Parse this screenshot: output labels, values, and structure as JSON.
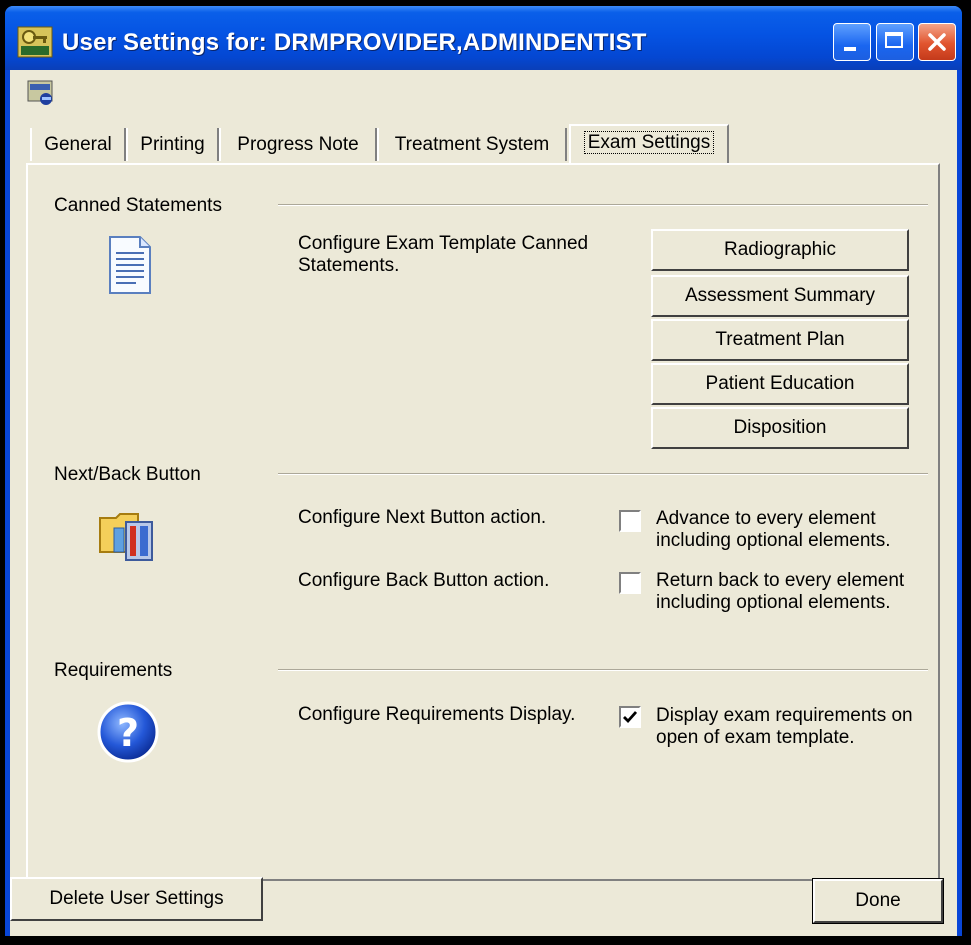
{
  "window": {
    "title": "User Settings for: DRMPROVIDER,ADMINDENTIST"
  },
  "tabs": [
    {
      "label": "General"
    },
    {
      "label": "Printing"
    },
    {
      "label": "Progress Note"
    },
    {
      "label": "Treatment System"
    },
    {
      "label": "Exam Settings",
      "active": true
    }
  ],
  "canned": {
    "heading": "Canned Statements",
    "description": "Configure Exam Template Canned Statements.",
    "buttons": [
      "Radiographic",
      "Assessment Summary",
      "Treatment Plan",
      "Patient Education",
      "Disposition"
    ]
  },
  "nextback": {
    "heading": "Next/Back Button",
    "next_label": "Configure Next Button action.",
    "next_option": "Advance to every element including optional elements.",
    "next_checked": false,
    "back_label": "Configure Back Button action.",
    "back_option": "Return back to every element including optional elements.",
    "back_checked": false
  },
  "requirements": {
    "heading": "Requirements",
    "label": "Configure Requirements Display.",
    "option": "Display exam requirements on open of exam template.",
    "checked": true
  },
  "footer": {
    "delete_label": "Delete User Settings",
    "done_label": "Done"
  },
  "icons": {
    "app": "keys-icon",
    "toolbar": "settings-icon",
    "canned": "document-icon",
    "nextback": "folder-tools-icon",
    "requirements": "help-icon"
  }
}
